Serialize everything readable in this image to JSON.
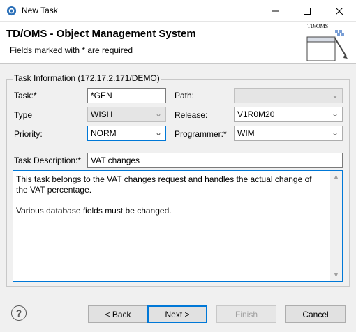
{
  "window": {
    "title": "New Task"
  },
  "header": {
    "title": "TD/OMS - Object Management System",
    "subtitle": "Fields marked with * are required",
    "logo_text": "TD/OMS"
  },
  "group": {
    "label": "Task Information (172.17.2.171/DEMO)"
  },
  "form": {
    "task_label": "Task:*",
    "task_value": "*GEN",
    "path_label": "Path:",
    "path_value": "",
    "type_label": "Type",
    "type_value": "WISH",
    "release_label": "Release:",
    "release_value": "V1R0M20",
    "priority_label": "Priority:",
    "priority_value": "NORM",
    "programmer_label": "Programmer:*",
    "programmer_value": "WIM",
    "description_label": "Task Description:*",
    "description_value": "VAT changes",
    "details_line1": "This task belongs to the VAT changes request and handles the actual change of the VAT percentage.",
    "details_line2": "Various database fields must be changed."
  },
  "footer": {
    "help_label": "?",
    "back_label": "< Back",
    "next_label": "Next >",
    "finish_label": "Finish",
    "cancel_label": "Cancel"
  },
  "colors": {
    "accent": "#0078d7",
    "background": "#f0f0f0"
  }
}
